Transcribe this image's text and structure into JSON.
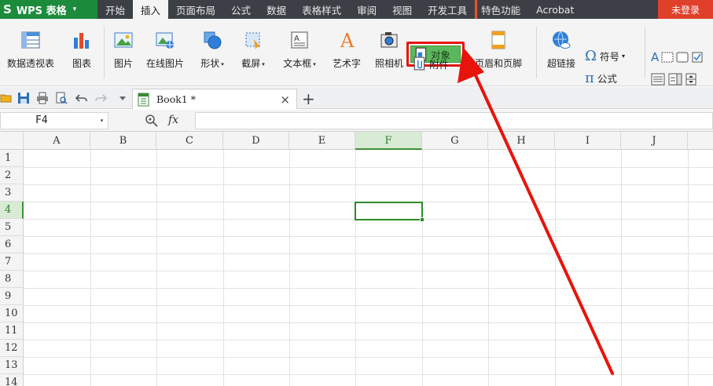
{
  "app": {
    "logo_mark": "S",
    "name": "WPS 表格",
    "caret": "▾"
  },
  "menu": {
    "items": [
      "开始",
      "插入",
      "页面布局",
      "公式",
      "数据",
      "表格样式",
      "审阅",
      "视图",
      "开发工具",
      "特色功能",
      "Acrobat"
    ],
    "active_index": 1,
    "login": "未登录"
  },
  "ribbon": {
    "pivot": "数据透视表",
    "chart": "图表",
    "picture": "图片",
    "online_picture": "在线图片",
    "shapes": "形状",
    "screenshot": "截屏",
    "textbox": "文本框",
    "wordart": "艺术字",
    "camera": "照相机",
    "object": "对象",
    "attachment": "附件",
    "header_footer": "页眉和页脚",
    "hyperlink": "超链接",
    "symbol": "符号",
    "formula": "公式",
    "dropdown_mark": "▾"
  },
  "tab": {
    "name": "Book1 *",
    "close": "×",
    "new": "+"
  },
  "formula_bar": {
    "cell_ref": "F4",
    "fx": "fx",
    "value": ""
  },
  "sheet": {
    "columns": [
      "A",
      "B",
      "C",
      "D",
      "E",
      "F",
      "G",
      "H",
      "I",
      "J"
    ],
    "rows": [
      "1",
      "2",
      "3",
      "4",
      "5",
      "6",
      "7",
      "8",
      "9",
      "10",
      "11",
      "12",
      "13",
      "14"
    ],
    "selected_column": "F",
    "selected_row": "4"
  },
  "colors": {
    "menubar": "#3c3f45",
    "brand_green": "#1c8c3c",
    "login_red": "#e0402a",
    "highlight_red": "#e8140c",
    "object_green": "#5cb85c",
    "selection_green": "#2f8a2a"
  },
  "icons": {
    "pivot": "pivot-table-icon",
    "chart": "bar-chart-icon",
    "picture": "picture-icon",
    "online_picture": "online-picture-icon",
    "shapes": "shapes-icon",
    "screenshot": "screenshot-icon",
    "textbox": "textbox-icon",
    "wordart": "wordart-icon",
    "camera": "camera-icon",
    "object": "object-icon",
    "attachment": "attachment-icon",
    "header_footer": "header-footer-icon",
    "hyperlink": "hyperlink-icon",
    "symbol": "omega-icon",
    "formula": "pi-icon"
  }
}
